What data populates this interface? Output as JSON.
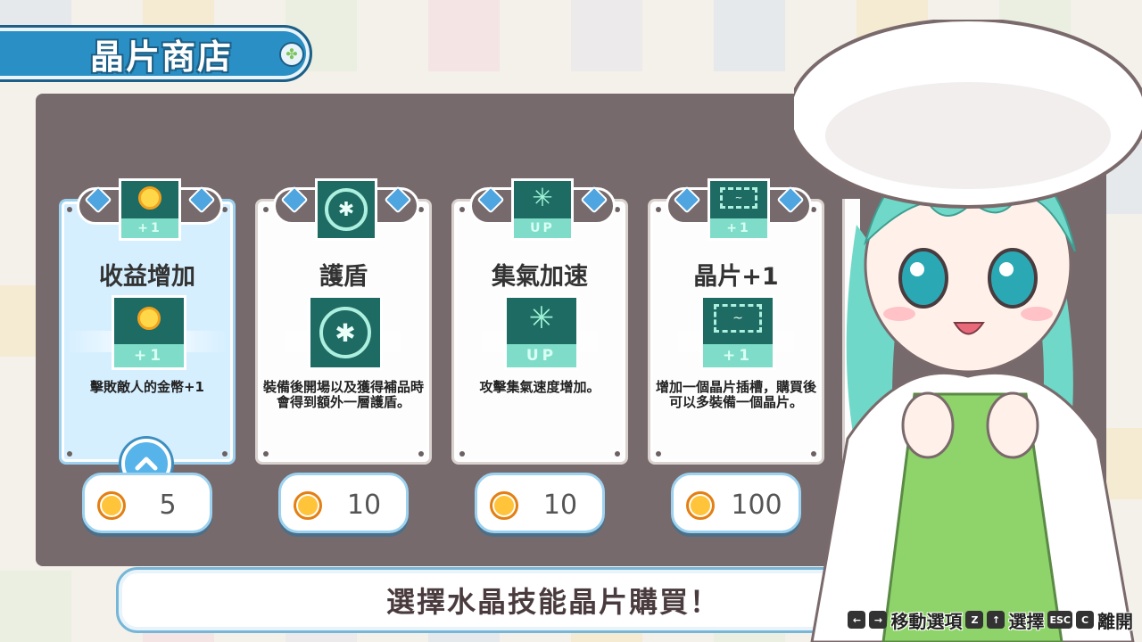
{
  "shop": {
    "title": "晶片商店",
    "message": "選擇水晶技能晶片購買！"
  },
  "cards": [
    {
      "title": "收益增加",
      "description": "擊敗敵人的金幣+1",
      "icon": "coin-plus-one-icon",
      "icon_label": "+1",
      "price": "5",
      "selected": true
    },
    {
      "title": "護盾",
      "description": "裝備後開場以及獲得補品時會得到額外一層護盾。",
      "icon": "shield-icon",
      "icon_label": "",
      "price": "10",
      "selected": false
    },
    {
      "title": "集氣加速",
      "description": "攻擊集氣速度增加。",
      "icon": "charge-up-icon",
      "icon_label": "UP",
      "price": "10",
      "selected": false
    },
    {
      "title": "晶片+1",
      "description": "增加一個晶片插槽，購買後可以多裝備一個晶片。",
      "icon": "chip-plus-one-icon",
      "icon_label": "+1",
      "price": "100",
      "selected": false
    }
  ],
  "controls": {
    "move_keys": [
      "←",
      "→"
    ],
    "move_label": "移動選項",
    "select_keys": [
      "Z",
      "↑"
    ],
    "select_label": "選擇",
    "exit_keys": [
      "ESC",
      "C"
    ],
    "exit_label": "離開"
  },
  "colors": {
    "panel": "#776a6c",
    "accent_blue": "#2a8fc4",
    "selected_card": "#d6efff",
    "icon_teal": "#1e6b64",
    "coin": "#ffc43a"
  }
}
